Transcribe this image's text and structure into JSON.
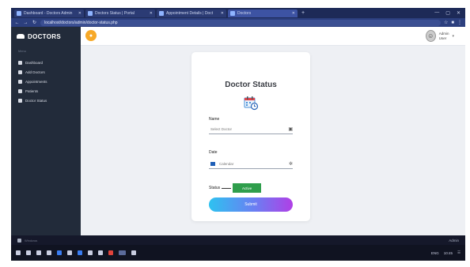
{
  "browser": {
    "tabs": [
      {
        "title": "Dashboard - Doctors Admin"
      },
      {
        "title": "Doctors Status | Portal"
      },
      {
        "title": "Appointment Details | Doct"
      },
      {
        "title": "Doctors"
      }
    ],
    "new_tab": "+",
    "controls": [
      "—",
      "▢",
      "✕"
    ],
    "url": "localhost/doctors/admin/doctor-status.php"
  },
  "sidebar": {
    "brand": "DOCTORS",
    "caption": "Menu",
    "items": [
      {
        "label": "Dashboard",
        "icon": "home-icon"
      },
      {
        "label": "Add Doctors",
        "icon": "plus-icon"
      },
      {
        "label": "Appointments",
        "icon": "calendar-icon"
      },
      {
        "label": "Patients",
        "icon": "users-icon"
      },
      {
        "label": "Doctor Status",
        "icon": "status-icon"
      }
    ]
  },
  "header": {
    "toggle_icon": "menu-toggle-icon",
    "user_name": "Admin",
    "user_role": "User",
    "caret": "▾"
  },
  "card": {
    "title": "Doctor Status",
    "name_label": "Name",
    "name_value": "Select Doctor",
    "date_label": "Date",
    "date_value": "Calendar",
    "status_label": "Status",
    "status_value": "Active",
    "submit_label": "Submit"
  },
  "footer": {
    "left": "Windows",
    "right": "Admin"
  },
  "taskbar": {
    "tray": [
      "ENG",
      "10:45",
      "☰"
    ]
  },
  "colors": {
    "sidebar": "#222b3a",
    "accent_orange": "#f7a928",
    "status_green": "#2f9e4c",
    "gradient_start": "#2ec2f0",
    "gradient_end": "#b03fe6"
  }
}
